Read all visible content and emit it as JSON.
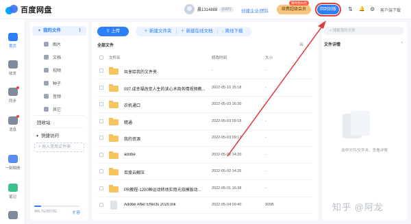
{
  "app": {
    "name": "百度网盘"
  },
  "header": {
    "username": "晨1314888",
    "svip_badge": "SVIP1",
    "create_team": "创建企业/团队",
    "vip_button": "续费超级会员",
    "vip_badge": "限时领20元",
    "client_button": "回到旧版",
    "sort_icon": "⇅",
    "bell_icon": "🔔",
    "settings_icon": "⚙",
    "download_client": "客户端下载"
  },
  "rail": [
    {
      "label": "首页",
      "icon": "cloud-icon"
    },
    {
      "label": "收发",
      "icon": "inbox-icon"
    },
    {
      "label": "同步",
      "icon": "sync-icon"
    },
    {
      "label": "消息",
      "icon": "message-icon"
    },
    {
      "label": "一刻相册",
      "icon": "album-icon"
    },
    {
      "label": "笔记",
      "icon": "note-icon"
    },
    {
      "label": "",
      "icon": "apps-icon"
    }
  ],
  "sidebar": {
    "my_files": "我的文件",
    "categories": [
      "图片",
      "文档",
      "视频",
      "种子",
      "音频",
      "其它"
    ],
    "recycle": "回收站",
    "quick_access": "快捷访问",
    "add_quick": "+ 拖入常用文件夹",
    "quota": "456.7G/3072G",
    "quota_fraction": 0.15,
    "expand": "扩容"
  },
  "toolbar": {
    "upload": "上传",
    "new_folder": "新建文件夹",
    "new_online_doc": "新建在线文档",
    "offline_download": "离线下载"
  },
  "breadcrumb": "全部文件",
  "table": {
    "headers": [
      "文件名",
      "修改时间",
      "大小"
    ],
    "rows": [
      {
        "name": "共享给我的文件夹",
        "time": "-",
        "size": "-",
        "type": "folder"
      },
      {
        "name": "097.成幸福改变人生的读心术商务情视频教...",
        "time": "2022-05-10 15:18",
        "size": "-",
        "type": "folder"
      },
      {
        "name": "农机通口",
        "time": "2022-05-03 16:30",
        "size": "-",
        "type": "folder"
      },
      {
        "name": "精通",
        "time": "2022-05-03 09:18",
        "size": "-",
        "type": "folder"
      },
      {
        "name": "我的资源",
        "time": "2022-05-03 09:17",
        "size": "-",
        "type": "folder"
      },
      {
        "name": "adobe",
        "time": "2022-05-02 14:20",
        "size": "-",
        "type": "folder"
      },
      {
        "name": "百度云解压",
        "time": "2022-05-02 14:25",
        "size": "-",
        "type": "folder"
      },
      {
        "name": "PR教程-1200种运动转场实用光效模版动...",
        "time": "2022-05-01 16:38",
        "size": "-",
        "type": "folder"
      },
      {
        "name": "Adobe After Effects 2020.lnk",
        "time": "2022-05-04 09:40",
        "size": "905B",
        "type": "file"
      }
    ]
  },
  "detail": {
    "search_placeholder": "搜索我的文件",
    "title": "文件详情",
    "empty_text": "选中文件/文件夹，查看详情"
  },
  "watermark": "知乎 @阿龙",
  "colors": {
    "accent": "#2d7ff9",
    "annotation": "#e23b3b",
    "folder": "#f8c45c"
  }
}
